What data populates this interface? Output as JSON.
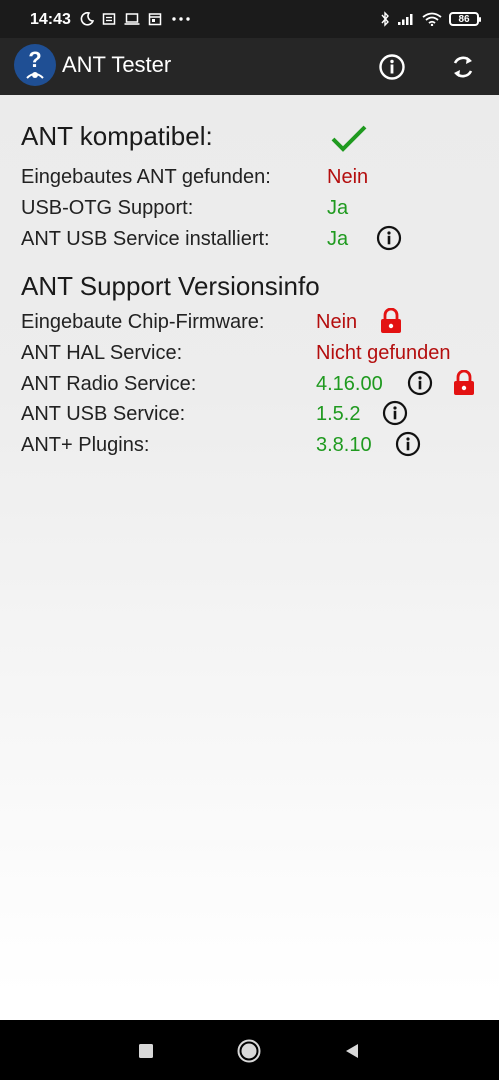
{
  "status_bar": {
    "time": "14:43",
    "battery": "86",
    "icons_left": [
      "moon-icon",
      "notification-icon",
      "laptop-icon",
      "calendar-icon",
      "more-icon"
    ],
    "icons_right": [
      "bluetooth-icon",
      "signal-icon",
      "wifi-icon",
      "battery-icon"
    ]
  },
  "app_bar": {
    "title": "ANT Tester",
    "actions": [
      "info-icon",
      "refresh-icon"
    ]
  },
  "compat": {
    "label": "ANT kompatibel:",
    "status_icon": "checkmark-icon"
  },
  "checks": [
    {
      "label": "Eingebautes ANT gefunden:",
      "value": "Nein",
      "color": "#b40e0e"
    },
    {
      "label": "USB-OTG Support:",
      "value": "Ja",
      "color": "#1f9a1f"
    },
    {
      "label": "ANT USB Service installiert:",
      "value": "Ja",
      "color": "#1f9a1f"
    }
  ],
  "versions": {
    "heading": "ANT Support Versionsinfo",
    "items": [
      {
        "label": "Eingebaute Chip-Firmware:",
        "value": "Nein"
      },
      {
        "label": "ANT HAL Service:",
        "value": "Nicht gefunden"
      },
      {
        "label": "ANT Radio Service:",
        "value": "4.16.00"
      },
      {
        "label": "ANT USB Service:",
        "value": "1.5.2"
      },
      {
        "label": "ANT+ Plugins:",
        "value": "3.8.10"
      }
    ]
  },
  "nav_bar": {
    "buttons": [
      "recents-icon",
      "home-icon",
      "back-icon"
    ]
  }
}
